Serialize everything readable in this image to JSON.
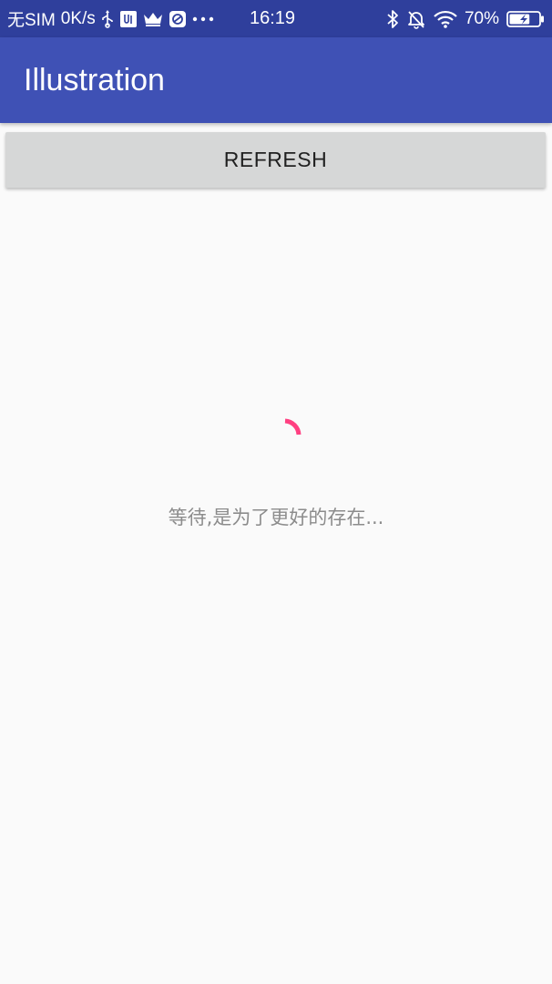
{
  "status_bar": {
    "carrier": "无SIM",
    "net_speed": "0K/s",
    "time": "16:19",
    "battery_percent": "70%",
    "battery_level": 0.7,
    "icons_left": [
      "usb-icon",
      "usb-debug-icon",
      "crown-icon",
      "browser-icon",
      "more-icon"
    ],
    "icons_right": [
      "bluetooth-icon",
      "mute-icon",
      "wifi-icon",
      "battery-icon"
    ]
  },
  "app_bar": {
    "title": "Illustration",
    "color": "#3f51b5"
  },
  "main": {
    "refresh_label": "REFRESH",
    "loading_text": "等待,是为了更好的存在...",
    "spinner_color": "#ff4081"
  }
}
